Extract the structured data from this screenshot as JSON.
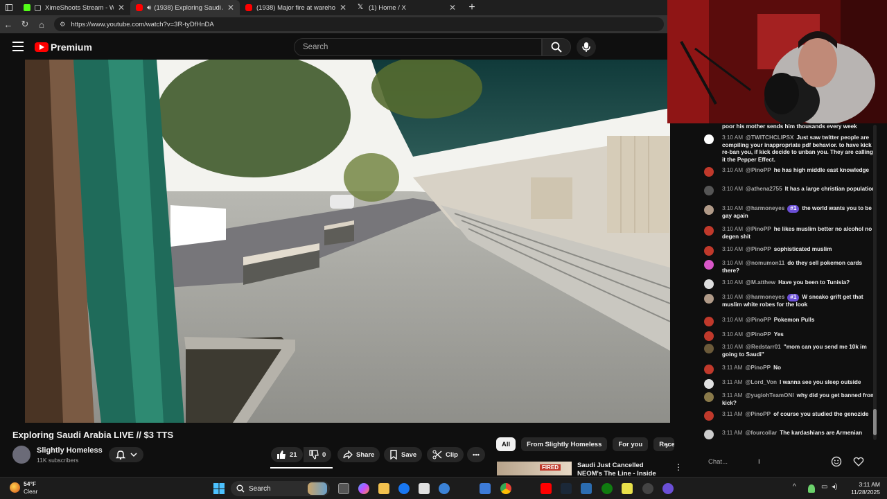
{
  "browser": {
    "tabs": [
      {
        "title": "XimeShoots Stream - Watch",
        "favicon_color": "#53fc18",
        "active": false
      },
      {
        "title": "(1938) Exploring Saudi Arabia",
        "favicon_color": "#ff0000",
        "active": true
      },
      {
        "title": "(1938) Major fire at warehouses d",
        "favicon_color": "#ff0000",
        "active": false
      },
      {
        "title": "(1) Home / X",
        "favicon_color": "#000000",
        "active": false
      }
    ],
    "new_tab": "+",
    "url": "https://www.youtube.com/watch?v=3R-tyDfHnDA"
  },
  "youtube": {
    "logo_text": "Premium",
    "search_placeholder": "Search"
  },
  "video": {
    "title": "Exploring Saudi Arabia LIVE // $3 TTS",
    "channel": "Slightly Homeless",
    "subscribers": "11K subscribers",
    "likes": "21",
    "dislikes": "0",
    "share_label": "Share",
    "save_label": "Save",
    "clip_label": "Clip"
  },
  "chips": [
    "All",
    "From Slightly Homeless",
    "For you",
    "Rece"
  ],
  "recommendation": {
    "title": "Saudi Just Cancelled NEOM's The Line - Inside the $8.8T",
    "thumb_text": "FIRED"
  },
  "chat": {
    "messages": [
      {
        "time": "",
        "user": "",
        "badge": "",
        "text": "poor his mother sends him thousands every week",
        "avatar": ""
      },
      {
        "time": "3:10 AM",
        "user": "@TWITCHCLIPSX",
        "badge": "",
        "text": "Just saw twitter people are compiling your inappropriate pdf behavior. to have kick re-ban you, if kick decide to unban you. They are calling it the Pepper Effect.",
        "avatar": "#ffffff"
      },
      {
        "time": "3:10 AM",
        "user": "@PinoPP",
        "badge": "",
        "text": "he has high middle east knowledge",
        "avatar": "#c0392b"
      },
      {
        "time": "3:10 AM",
        "user": "@athena2755",
        "badge": "",
        "text": "It has a large christian population",
        "avatar": "#555555"
      },
      {
        "time": "3:10 AM",
        "user": "@harmoneyes",
        "badge": "#1",
        "text": "the world wants you to be gay again",
        "avatar": "#b09a88"
      },
      {
        "time": "3:10 AM",
        "user": "@PinoPP",
        "badge": "",
        "text": "he likes muslim better no alcohol no degen shit",
        "avatar": "#c0392b"
      },
      {
        "time": "3:10 AM",
        "user": "@PinoPP",
        "badge": "",
        "text": "sophisticated muslim",
        "avatar": "#c0392b"
      },
      {
        "time": "3:10 AM",
        "user": "@nomumon11",
        "badge": "",
        "text": "do they sell pokemon cards there?",
        "avatar": "#d957c8"
      },
      {
        "time": "3:10 AM",
        "user": "@M.atthew",
        "badge": "",
        "text": "Have you been to Tunisia?",
        "avatar": "#dddddd"
      },
      {
        "time": "3:10 AM",
        "user": "@harmoneyes",
        "badge": "#1",
        "text": "W sneako grift get that muslim white robes for the look",
        "avatar": "#b09a88"
      },
      {
        "time": "3:10 AM",
        "user": "@PinoPP",
        "badge": "",
        "text": "Pokemon Pulls",
        "avatar": "#c0392b"
      },
      {
        "time": "3:10 AM",
        "user": "@PinoPP",
        "badge": "",
        "text": "Yes",
        "avatar": "#c0392b"
      },
      {
        "time": "3:10 AM",
        "user": "@Redstarr01",
        "badge": "",
        "text": "\"mom can you send me 10k im going to Saudi\"",
        "avatar": "#6b5a3a"
      },
      {
        "time": "3:11 AM",
        "user": "@PinoPP",
        "badge": "",
        "text": "No",
        "avatar": "#c0392b"
      },
      {
        "time": "3:11 AM",
        "user": "@Lord_Von",
        "badge": "",
        "text": "I wanna see you sleep outside",
        "avatar": "#e0e0e0"
      },
      {
        "time": "3:11 AM",
        "user": "@yugiohTeamONI",
        "badge": "",
        "text": "why did you get banned from kick?",
        "avatar": "#8a7a4a"
      },
      {
        "time": "3:11 AM",
        "user": "@PinoPP",
        "badge": "",
        "text": "of course you studied the genozide",
        "avatar": "#c0392b"
      },
      {
        "time": "3:11 AM",
        "user": "@fourcollar",
        "badge": "",
        "text": "The kardashians are Armenian",
        "avatar": "#cccccc"
      }
    ],
    "input_placeholder": "Chat..."
  },
  "taskbar": {
    "temperature": "54°F",
    "condition": "Clear",
    "search_label": "Search",
    "time": "3:11 AM",
    "date": "11/28/2025"
  }
}
